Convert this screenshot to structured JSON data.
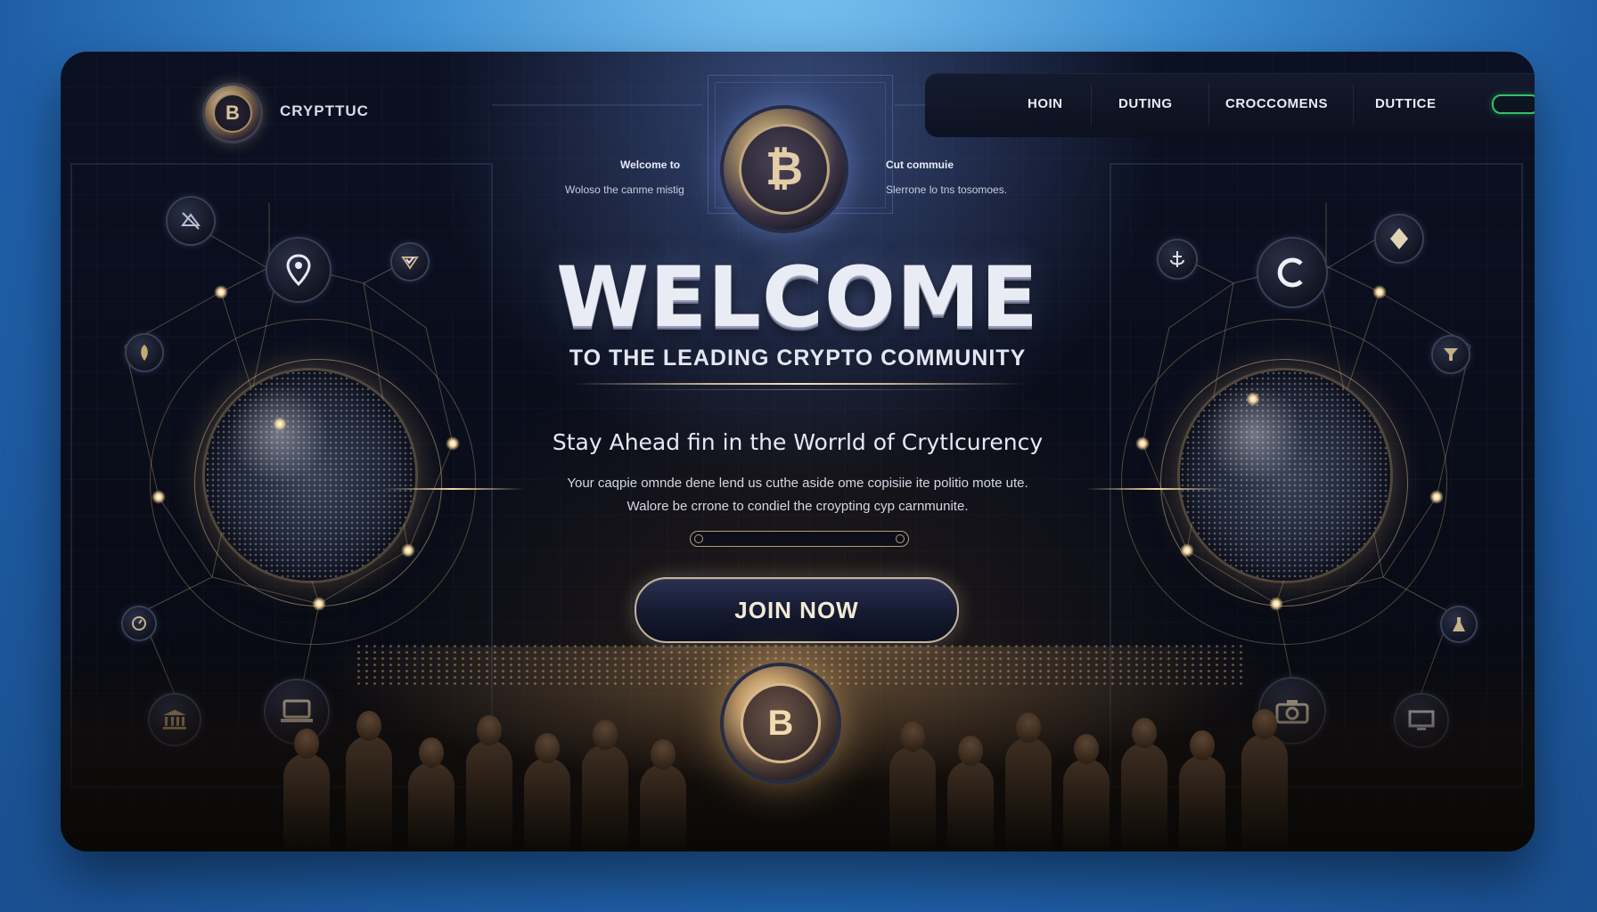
{
  "brand": {
    "name": "CRYPTTUC",
    "logo_letter": "B"
  },
  "nav": {
    "items": [
      {
        "label": "HOIN"
      },
      {
        "label": "DUTING"
      },
      {
        "label": "CROCCOMENS"
      },
      {
        "label": "DUTTICE"
      }
    ]
  },
  "top_coin": {
    "symbol": "₿"
  },
  "side_texts": {
    "left_title": "Welcome to",
    "left_sub": "Woloso the canme mistig",
    "right_title": "Cut commuie",
    "right_sub": "Slerrone lo tns tosomoes."
  },
  "hero": {
    "title": "WELCOME",
    "subtitle": "TO THE LEADING  CRYPTO COMMUNITY",
    "tagline": "Stay Ahead fin in the Worrld of Crytlcurency",
    "desc_line1": "Your caqpie omnde dene lend us cuthe aside ome copisiie ite politio mote ute.",
    "desc_line2": "Walore be crrone to condiel the croypting cyp carnmunite.",
    "cta_label": "JOIN NOW"
  },
  "bottom_coin": {
    "symbol": "B"
  },
  "colors": {
    "accent_gold": "#c9b48c",
    "toggle_green": "#35c06c",
    "background_blue": "#3f8fd2"
  }
}
